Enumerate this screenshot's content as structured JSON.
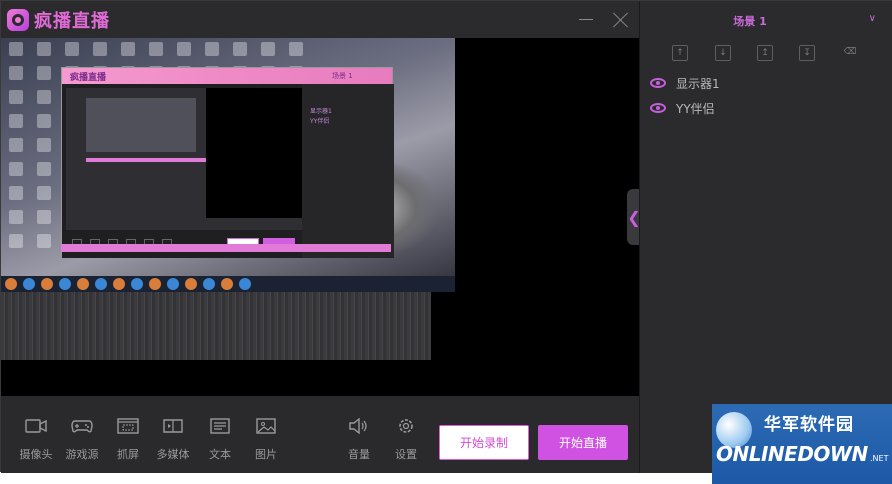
{
  "app": {
    "title": "疯播直播"
  },
  "scene": {
    "name": "场景 1"
  },
  "sources": [
    {
      "label": "显示器1"
    },
    {
      "label": "YY伴侣"
    }
  ],
  "source_tools": [
    "move-top",
    "move-down",
    "move-top-alt",
    "move-bottom",
    "delete"
  ],
  "toolbar": {
    "items": [
      {
        "label": "摄像头",
        "icon": "camera-icon"
      },
      {
        "label": "游戏源",
        "icon": "gamepad-icon"
      },
      {
        "label": "抓屏",
        "icon": "screen-capture-icon"
      },
      {
        "label": "多媒体",
        "icon": "media-icon"
      },
      {
        "label": "文本",
        "icon": "text-icon"
      },
      {
        "label": "图片",
        "icon": "image-icon"
      },
      {
        "label": "音量",
        "icon": "volume-icon"
      },
      {
        "label": "设置",
        "icon": "settings-icon"
      }
    ],
    "record_label": "开始录制",
    "live_label": "开始直播"
  },
  "watermark": {
    "cn": "华军软件园",
    "en": "ONLINEDOWN",
    "net": ".NET"
  },
  "colors": {
    "accent": "#d052e3",
    "background": "#1f1f21",
    "panel": "#2b2b2e"
  }
}
